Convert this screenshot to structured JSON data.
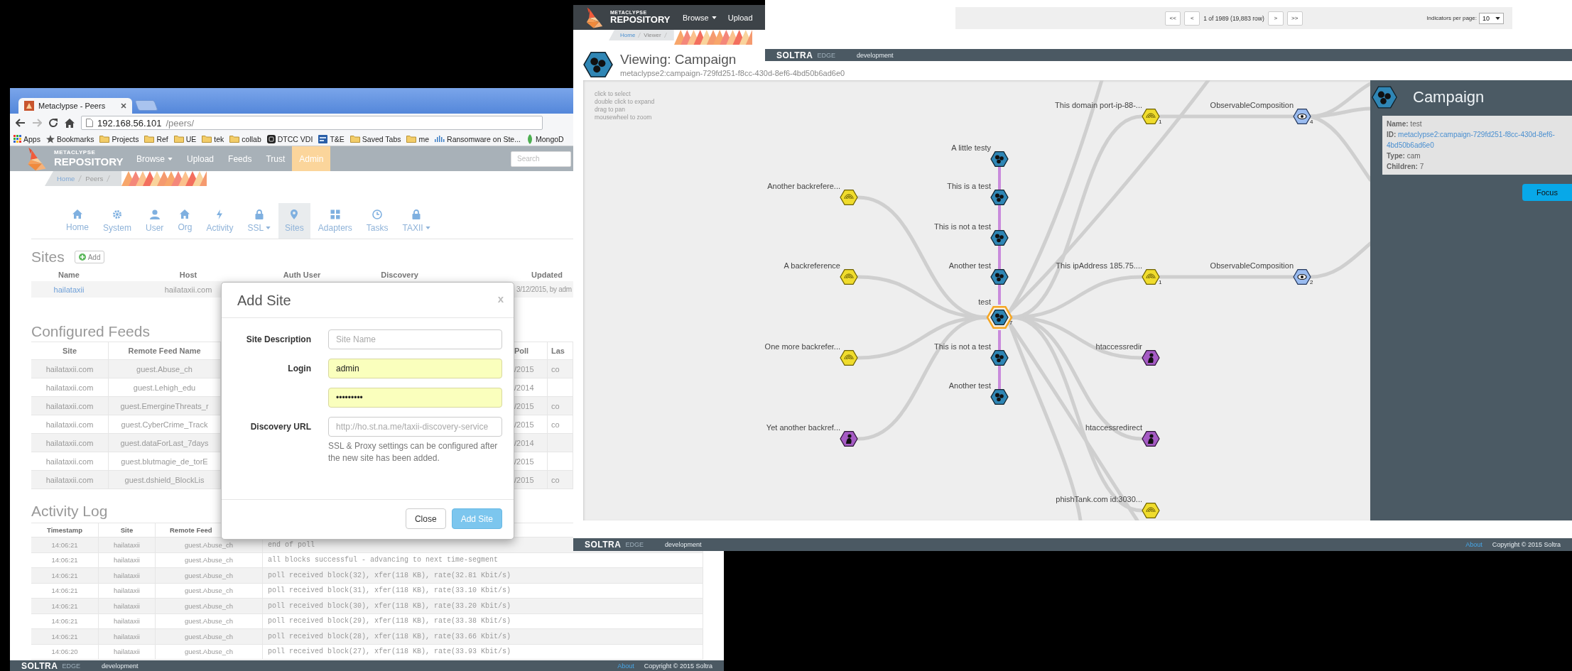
{
  "browser": {
    "tab_title": "Metaclypse - Peers",
    "url_host": "192.168.56.101",
    "url_path": "/peers/",
    "bookmarks": [
      {
        "label": "Apps",
        "kind": "apps"
      },
      {
        "label": "Bookmarks",
        "kind": "star"
      },
      {
        "label": "Projects",
        "kind": "folder"
      },
      {
        "label": "Ref",
        "kind": "folder"
      },
      {
        "label": "UE",
        "kind": "folder"
      },
      {
        "label": "tek",
        "kind": "folder"
      },
      {
        "label": "collab",
        "kind": "folder"
      },
      {
        "label": "DTCC VDI",
        "kind": "app"
      },
      {
        "label": "T&E",
        "kind": "badge"
      },
      {
        "label": "Saved Tabs",
        "kind": "folder"
      },
      {
        "label": "me",
        "kind": "folder"
      },
      {
        "label": "Ransomware on Ste...",
        "kind": "bars"
      },
      {
        "label": "MongoD",
        "kind": "leaf"
      }
    ],
    "navbar": {
      "brand_top": "METACLYPSE",
      "brand_bottom": "REPOSITORY",
      "search_placeholder": "Search",
      "items": [
        {
          "label": "Browse",
          "dropdown": true,
          "selected": false
        },
        {
          "label": "Upload",
          "dropdown": false,
          "selected": false
        },
        {
          "label": "Feeds",
          "dropdown": false,
          "selected": false
        },
        {
          "label": "Trust",
          "dropdown": false,
          "selected": false
        },
        {
          "label": "Admin",
          "dropdown": false,
          "selected": true
        }
      ]
    },
    "breadcrumb": [
      "Home",
      "Peers"
    ],
    "admin_tabs": [
      {
        "label": "Home",
        "kind": "home",
        "dropdown": false,
        "selected": false
      },
      {
        "label": "System",
        "kind": "gear",
        "dropdown": false,
        "selected": false
      },
      {
        "label": "User",
        "kind": "user",
        "dropdown": false,
        "selected": false
      },
      {
        "label": "Org",
        "kind": "home",
        "dropdown": false,
        "selected": false
      },
      {
        "label": "Activity",
        "kind": "bolt",
        "dropdown": false,
        "selected": false
      },
      {
        "label": "SSL",
        "kind": "lock",
        "dropdown": true,
        "selected": false
      },
      {
        "label": "Sites",
        "kind": "pin",
        "dropdown": false,
        "selected": true
      },
      {
        "label": "Adapters",
        "kind": "gift",
        "dropdown": false,
        "selected": false
      },
      {
        "label": "Tasks",
        "kind": "clock",
        "dropdown": false,
        "selected": false
      },
      {
        "label": "TAXII",
        "kind": "lock",
        "dropdown": true,
        "selected": false
      }
    ],
    "sites": {
      "title": "Sites",
      "add_label": "Add",
      "columns": [
        "Name",
        "Host",
        "Auth User",
        "Discovery",
        "Updated"
      ],
      "rows": [
        {
          "name": "hailataxii",
          "host": "hailataxii.com",
          "updated": "3/12/2015, by adm"
        }
      ]
    },
    "feeds": {
      "title": "Configured Feeds",
      "columns": {
        "site": "Site",
        "feed": "Remote Feed Name",
        "poll": "Poll",
        "column_6": "Las"
      },
      "rows": [
        {
          "site": "hailataxii.com",
          "feed": "guest.Abuse_ch",
          "poll": "/2015",
          "column_6": "co"
        },
        {
          "site": "hailataxii.com",
          "feed": "guest.Lehigh_edu",
          "poll": "/2014"
        },
        {
          "site": "hailataxii.com",
          "feed": "guest.EmergineThreats_r",
          "poll": "/2015",
          "column_6": "co"
        },
        {
          "site": "hailataxii.com",
          "feed": "guest.CyberCrime_Track",
          "poll": "/2015",
          "column_6": "co"
        },
        {
          "site": "hailataxii.com",
          "feed": "guest.dataForLast_7days",
          "poll": "/2014"
        },
        {
          "site": "hailataxii.com",
          "feed": "guest.blutmagie_de_torE",
          "poll": "/2015"
        },
        {
          "site": "hailataxii.com",
          "feed": "guest.dshield_BlockLis",
          "poll": "/2015",
          "column_6": "co"
        }
      ]
    },
    "activity": {
      "title": "Activity Log",
      "columns": [
        "Timestamp",
        "Site",
        "Remote Feed"
      ],
      "rows": [
        {
          "time": "14:06:21",
          "site": "hailataxii",
          "feed": "guest.Abuse_ch",
          "message": "end of poll"
        },
        {
          "time": "14:06:21",
          "site": "hailataxii",
          "feed": "guest.Abuse_ch",
          "message": "all blocks successful - advancing to next time-segment"
        },
        {
          "time": "14:06:21",
          "site": "hailataxii",
          "feed": "guest.Abuse_ch",
          "message": "poll received block(32), xfer(118 KB), rate(32.81 Kbit/s)"
        },
        {
          "time": "14:06:21",
          "site": "hailataxii",
          "feed": "guest.Abuse_ch",
          "message": "poll received block(31), xfer(118 KB), rate(33.10 Kbit/s)"
        },
        {
          "time": "14:06:21",
          "site": "hailataxii",
          "feed": "guest.Abuse_ch",
          "message": "poll received block(30), xfer(118 KB), rate(33.20 Kbit/s)"
        },
        {
          "time": "14:06:21",
          "site": "hailataxii",
          "feed": "guest.Abuse_ch",
          "message": "poll received block(29), xfer(118 KB), rate(33.38 Kbit/s)"
        },
        {
          "time": "14:06:21",
          "site": "hailataxii",
          "feed": "guest.Abuse_ch",
          "message": "poll received block(28), xfer(118 KB), rate(33.66 Kbit/s)"
        },
        {
          "time": "14:06:20",
          "site": "hailataxii",
          "feed": "guest.Abuse_ch",
          "message": "poll received block(27), xfer(118 KB), rate(33.93 Kbit/s)"
        }
      ]
    },
    "footer": {
      "brand": "SOLTRA",
      "brand_suffix": "EDGE",
      "environment": "development",
      "links": [
        "About"
      ],
      "copyright": "Copyright © 2015 Soltra"
    }
  },
  "dialog": {
    "title": "Add Site",
    "close_label": "x",
    "fields": [
      {
        "label": "Site Description",
        "placeholder": "Site Name",
        "autofilled": false
      },
      {
        "label": "Login",
        "value": "admin",
        "autofilled": true
      },
      {
        "value": "•••••••••",
        "autofilled": true
      },
      {
        "label": "Discovery URL",
        "placeholder": "http://ho.st.na.me/taxii-discovery-service",
        "help": "SSL & Proxy settings can be configured after the new site has been added.",
        "autofilled": false
      }
    ],
    "buttons": [
      {
        "label": "Close",
        "kind": "default",
        "disabled": false
      },
      {
        "label": "Add Site",
        "kind": "primary",
        "disabled": true
      }
    ]
  },
  "viewer": {
    "navbar": {
      "brand_top": "METACLYPSE",
      "brand_bottom": "REPOSITORY",
      "items": [
        {
          "label": "Browse",
          "dropdown": true,
          "selected": false
        },
        {
          "label": "Upload",
          "dropdown": false,
          "selected": false
        }
      ]
    },
    "breadcrumb": [
      "Home",
      "Viewer"
    ],
    "heading": "Viewing: Campaign",
    "subheading": "metaclypse2:campaign-729fd251-f8cc-430d-8ef6-4bd50b6ad6e0",
    "graph": {
      "hints": [
        "click to select",
        "double click to expand",
        "drag to pan",
        "mousewheel to zoom"
      ],
      "nodes": [
        {
          "label": "This domain port-ip-88-...",
          "kind": "indicator",
          "count": "1",
          "selected": false
        },
        {
          "label": "ObservableComposition",
          "kind": "observable",
          "count": "4",
          "selected": false
        },
        {
          "label": "A little testy",
          "kind": "campaign",
          "selected": false
        },
        {
          "label": "Another backrefere...",
          "kind": "indicator",
          "selected": false
        },
        {
          "label": "This is a test",
          "kind": "campaign",
          "selected": false
        },
        {
          "label": "This is not a test",
          "kind": "campaign",
          "selected": false
        },
        {
          "label": "A backreference",
          "kind": "indicator",
          "selected": false
        },
        {
          "label": "Another test",
          "kind": "campaign",
          "selected": false
        },
        {
          "label": "This ipAddress 185.75....",
          "kind": "indicator",
          "count": "1",
          "selected": false
        },
        {
          "label": "ObservableComposition",
          "kind": "observable",
          "count": "2",
          "selected": false
        },
        {
          "label": "test",
          "kind": "campaign",
          "count": "7",
          "selected": true
        },
        {
          "label": "One more backrefer...",
          "kind": "indicator",
          "selected": false
        },
        {
          "label": "This is not a test",
          "kind": "campaign",
          "selected": false
        },
        {
          "label": "htaccessredir",
          "kind": "actor",
          "selected": false
        },
        {
          "label": "Another test",
          "kind": "campaign",
          "selected": false
        },
        {
          "label": "Yet another backref...",
          "kind": "actor",
          "selected": false
        },
        {
          "label": "htaccessredirect",
          "kind": "actor",
          "selected": false
        },
        {
          "label": "phishTank.com id:3030...",
          "kind": "indicator",
          "selected": false
        }
      ]
    },
    "panel": {
      "title": "Campaign",
      "fields": [
        {
          "label": "Name:",
          "value": "test",
          "link": false
        },
        {
          "label": "ID:",
          "value": "metaclypse2:campaign-729fd251-f8cc-430d-8ef6-4bd50b6ad6e0",
          "link": true
        },
        {
          "label": "Type:",
          "value": "cam",
          "link": false
        },
        {
          "label": "Children:",
          "value": "7",
          "link": false
        }
      ],
      "button": "Focus"
    },
    "footer": {
      "brand": "SOLTRA",
      "brand_suffix": "EDGE",
      "environment": "development",
      "links": [
        "About"
      ],
      "copyright": "Copyright © 2015 Soltra"
    }
  },
  "back_window": {
    "first_buttons": [
      "<<",
      "<"
    ],
    "page_info": "1 of 1989 (19,883 row)",
    "last_buttons": [
      ">",
      ">>"
    ],
    "per_page_label": "Indicators per page:",
    "per_page_value": "10",
    "footer": {
      "brand": "SOLTRA",
      "brand_suffix": "EDGE",
      "environment": "development"
    }
  }
}
